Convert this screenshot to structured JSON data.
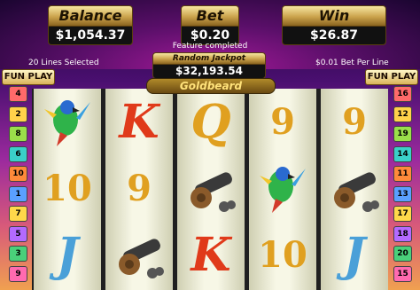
{
  "header": {
    "balance": {
      "label": "Balance",
      "value": "$1,054.37"
    },
    "bet": {
      "label": "Bet",
      "value": "$0.20"
    },
    "win": {
      "label": "Win",
      "value": "$26.87"
    },
    "status": "Feature completed",
    "jackpot": {
      "label": "Random Jackpot",
      "value": "$32,193.54"
    },
    "lines_selected": "20 Lines Selected",
    "bet_per_line": "$0.01 Bet Per Line"
  },
  "logo": "Goldbeard",
  "fun_play": {
    "left": "FUN PLAY",
    "right": "FUN PLAY"
  },
  "left_badges": [
    "4",
    "2",
    "8",
    "6",
    "10",
    "1",
    "7",
    "5",
    "3",
    "9"
  ],
  "right_badges": [
    "16",
    "12",
    "19",
    "14",
    "11",
    "13",
    "17",
    "18",
    "20",
    "15"
  ],
  "badge_colors": [
    "#ff6a6a",
    "#ffd24a",
    "#9adf4a",
    "#3ad0c8",
    "#ff8a3a",
    "#5aa0ff",
    "#ffd84a",
    "#b36aff",
    "#4ad07a",
    "#ff6ab0"
  ],
  "reels": [
    {
      "symbols": [
        {
          "kind": "parrot-icon",
          "text": ""
        },
        {
          "kind": "number",
          "text": "10"
        },
        {
          "kind": "letter",
          "text": "J"
        }
      ]
    },
    {
      "symbols": [
        {
          "kind": "letter",
          "text": "K"
        },
        {
          "kind": "number",
          "text": "9"
        },
        {
          "kind": "cannon-icon",
          "text": ""
        }
      ]
    },
    {
      "symbols": [
        {
          "kind": "letter",
          "text": "Q"
        },
        {
          "kind": "cannon-icon",
          "text": ""
        },
        {
          "kind": "letter",
          "text": "K"
        }
      ]
    },
    {
      "symbols": [
        {
          "kind": "number",
          "text": "9"
        },
        {
          "kind": "parrot-icon",
          "text": ""
        },
        {
          "kind": "number",
          "text": "10"
        }
      ]
    },
    {
      "symbols": [
        {
          "kind": "number",
          "text": "9"
        },
        {
          "kind": "cannon-icon",
          "text": ""
        },
        {
          "kind": "letter",
          "text": "J"
        }
      ]
    }
  ],
  "symbol_colors": {
    "J": "#4aa0d8",
    "K": "#e03a1a",
    "Q": "#e0a020",
    "9": "#e0a020",
    "10": "#e0a020"
  }
}
